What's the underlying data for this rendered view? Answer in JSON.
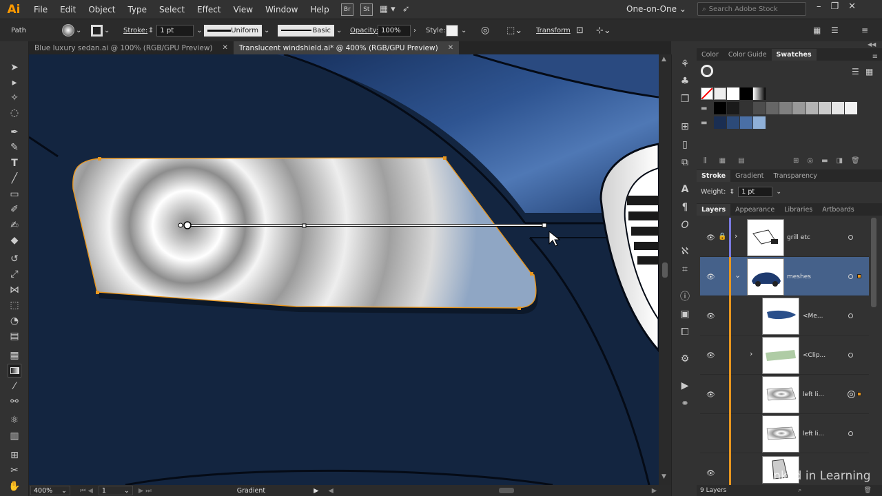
{
  "app": {
    "logo": "Ai"
  },
  "menubar": {
    "items": [
      "File",
      "Edit",
      "Object",
      "Type",
      "Select",
      "Effect",
      "View",
      "Window",
      "Help"
    ],
    "br": "Br",
    "st": "St",
    "workspace": "One-on-One",
    "stock_placeholder": "Search Adobe Stock"
  },
  "control": {
    "selection": "Path",
    "stroke_label": "Stroke:",
    "stroke_value": "1 pt",
    "profile": "Uniform",
    "brush": "Basic",
    "opacity_label": "Opacity:",
    "opacity_value": "100%",
    "style_label": "Style:",
    "transform": "Transform"
  },
  "tabs": [
    {
      "label": "Blue luxury sedan.ai @ 100% (RGB/GPU Preview)"
    },
    {
      "label": "Translucent windshield.ai* @ 400% (RGB/GPU Preview)"
    }
  ],
  "status": {
    "zoom": "400%",
    "artboard": "1",
    "tool": "Gradient"
  },
  "panels": {
    "top_tabs": [
      "Color",
      "Color Guide",
      "Swatches"
    ],
    "stroke_tabs": [
      "Stroke",
      "Gradient",
      "Transparency"
    ],
    "weight_label": "Weight:",
    "weight_value": "1 pt",
    "layers_tabs": [
      "Layers",
      "Appearance",
      "Libraries",
      "Artboards"
    ],
    "layers": [
      {
        "name": "grill etc"
      },
      {
        "name": "meshes"
      },
      {
        "name": "<Me..."
      },
      {
        "name": "<Clip..."
      },
      {
        "name": "left li..."
      },
      {
        "name": "left li..."
      }
    ],
    "layers_count": "9 Layers"
  },
  "colors": {
    "accent": "#e8961e",
    "canvas": "#132540",
    "selected_layer": "#45618a",
    "swatch_blues": [
      "#1a2e52",
      "#2c4a78",
      "#4a6fa5",
      "#8fb0d8"
    ]
  },
  "watermark": "Linked in Learning"
}
